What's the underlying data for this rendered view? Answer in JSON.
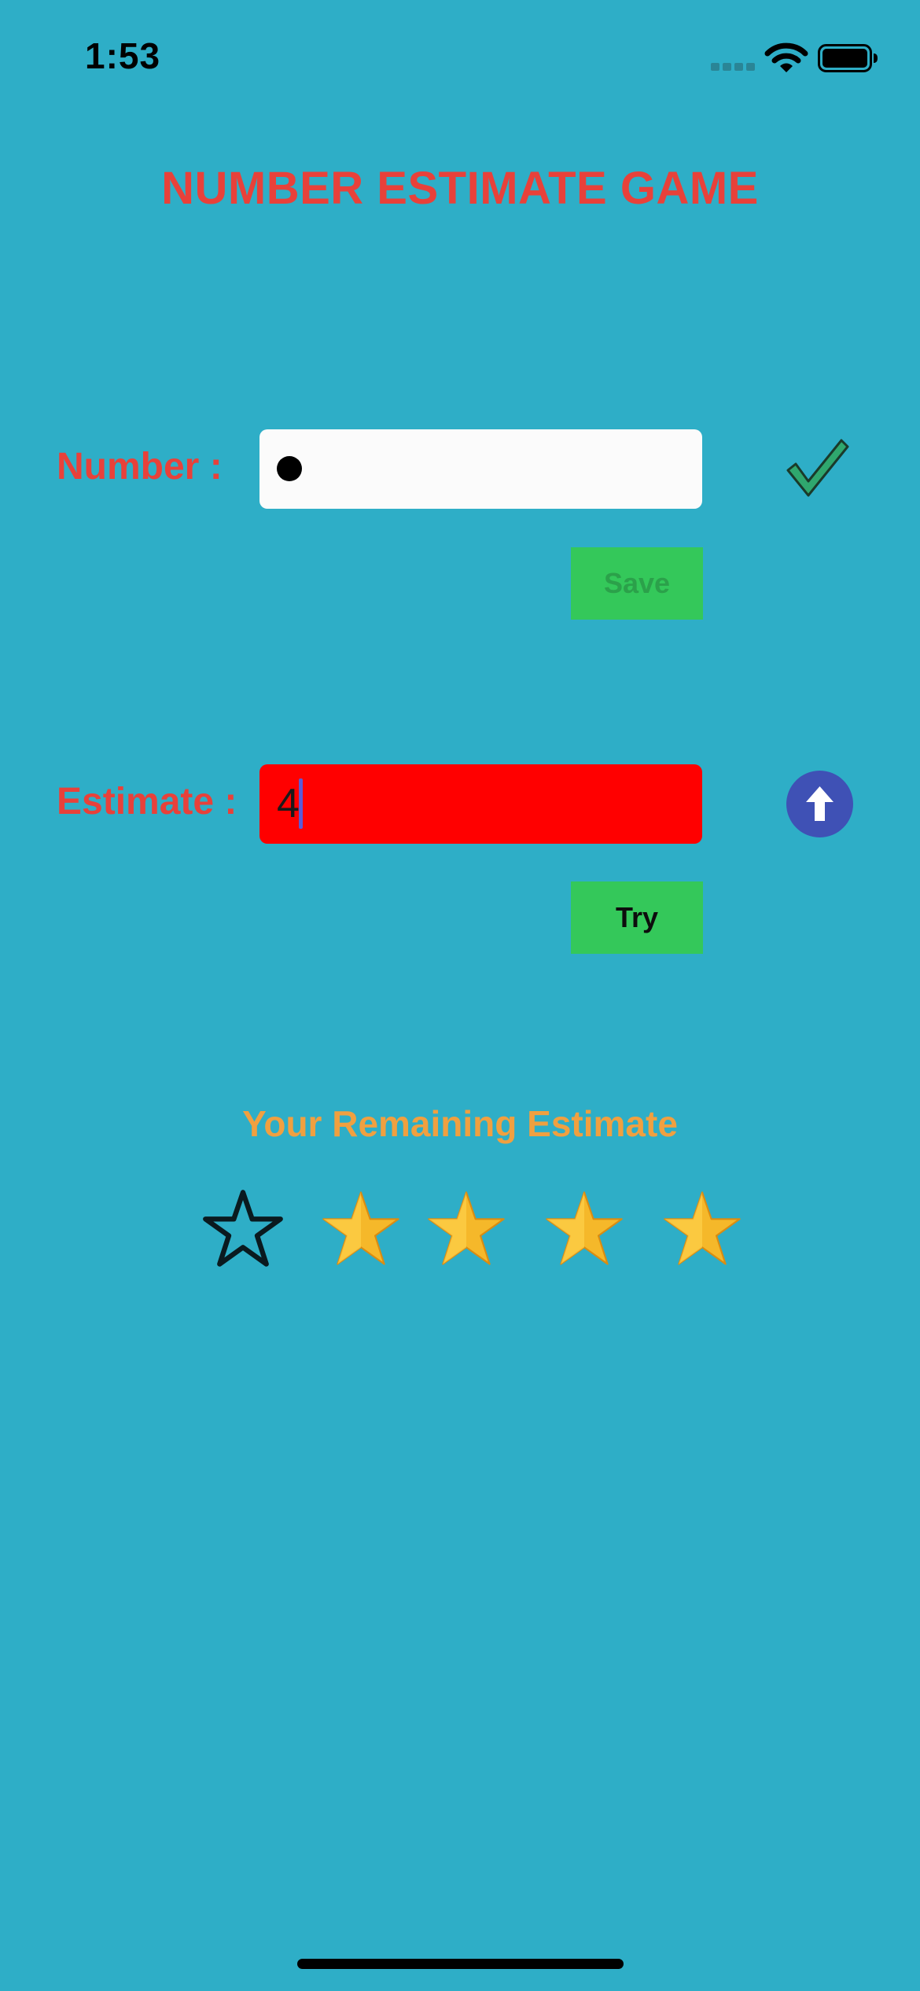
{
  "status_bar": {
    "time": "1:53",
    "icons": [
      "cellular-signal-icon",
      "wifi-icon",
      "battery-icon"
    ]
  },
  "game": {
    "title": "NUMBER ESTIMATE GAME",
    "number": {
      "label": "Number :",
      "value_masked": true,
      "status_icon": "checkmark-icon"
    },
    "save_button": "Save",
    "estimate": {
      "label": "Estimate :",
      "value": "4",
      "hint_icon": "arrow-up-icon"
    },
    "try_button": "Try",
    "remaining_label": "Your Remaining Estimate",
    "remaining_estimates": {
      "total": 5,
      "remaining": 4
    }
  },
  "colors": {
    "background": "#2eaec7",
    "title": "#e8413a",
    "labels": "#e8413a",
    "remaining_text": "#f0a040",
    "button": "#34c85a",
    "estimate_field": "#ff0000",
    "hint_circle": "#3f51b5",
    "star_fill": "#f5b82a"
  }
}
